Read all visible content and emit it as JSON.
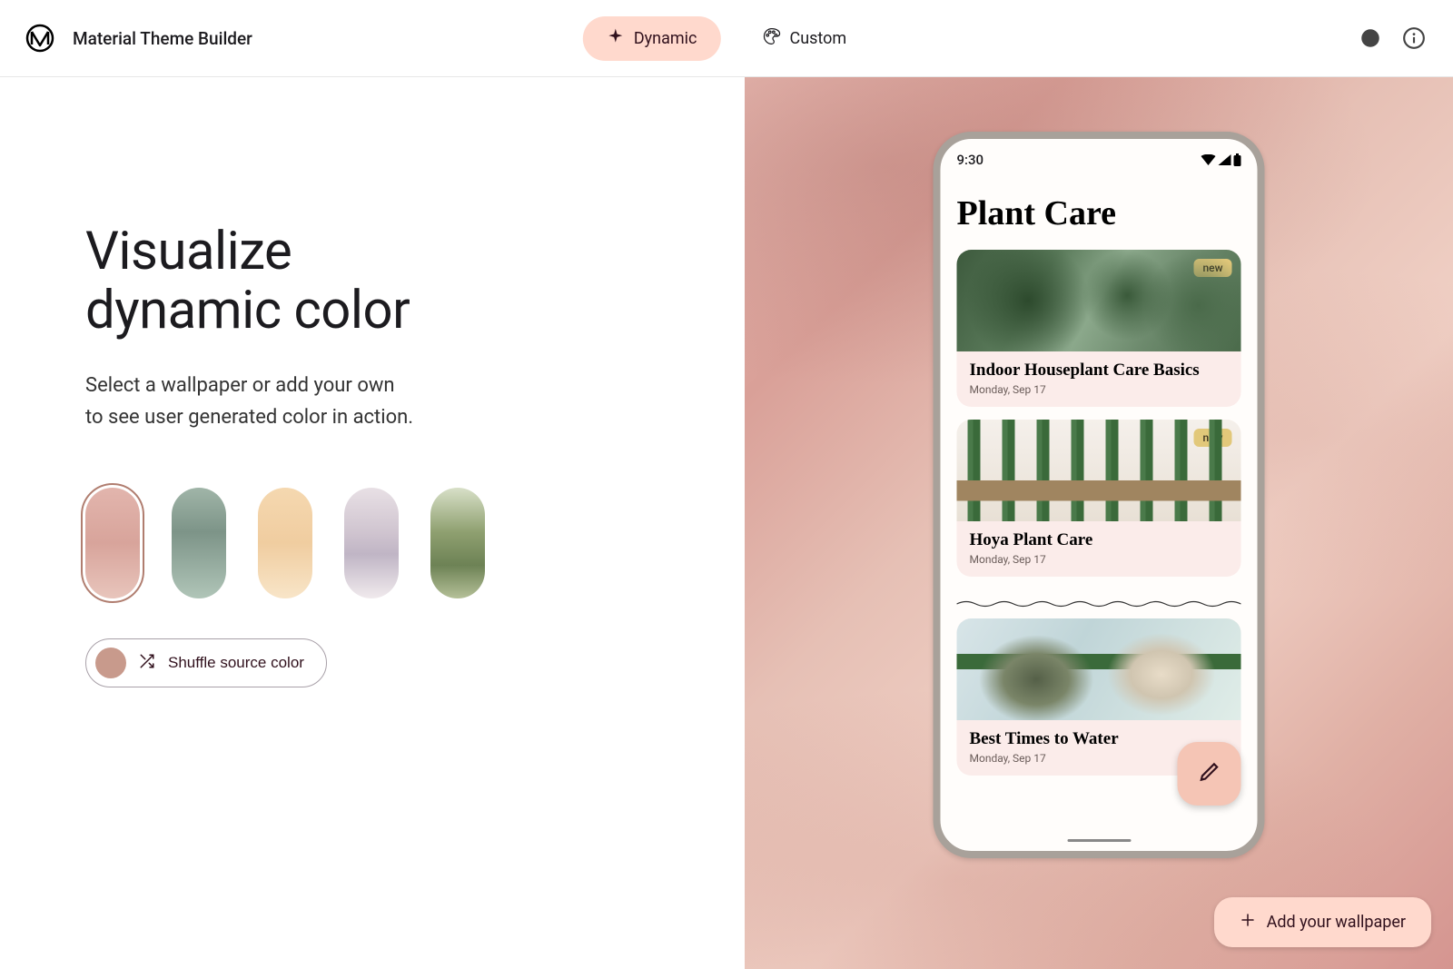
{
  "header": {
    "title": "Material Theme Builder",
    "tabs": [
      {
        "label": "Dynamic",
        "active": true
      },
      {
        "label": "Custom",
        "active": false
      }
    ]
  },
  "hero": {
    "title_line1": "Visualize",
    "title_line2": "dynamic color",
    "sub_line1": "Select a wallpaper or add your own",
    "sub_line2": "to see user generated color in action."
  },
  "shuffle": {
    "label": "Shuffle source color",
    "swatch_color": "#c89a8c"
  },
  "wallpapers": {
    "selected_index": 0,
    "items": [
      "desert-pink",
      "rock-green",
      "dunes-orange",
      "mountain-lavender",
      "hills-olive"
    ]
  },
  "phone": {
    "time": "9:30",
    "app_title": "Plant Care",
    "badge_new": "new",
    "cards": [
      {
        "title": "Indoor Houseplant Care Basics",
        "date": "Monday, Sep 17",
        "badge": true
      },
      {
        "title": "Hoya Plant Care",
        "date": "Monday, Sep 17",
        "badge": true
      },
      {
        "title": "Best Times to Water",
        "date": "Monday, Sep 17",
        "badge": false
      }
    ]
  },
  "add_wallpaper": {
    "label": "Add your wallpaper"
  },
  "colors": {
    "accent": "#ffd9cd",
    "on_accent": "#31111d"
  }
}
